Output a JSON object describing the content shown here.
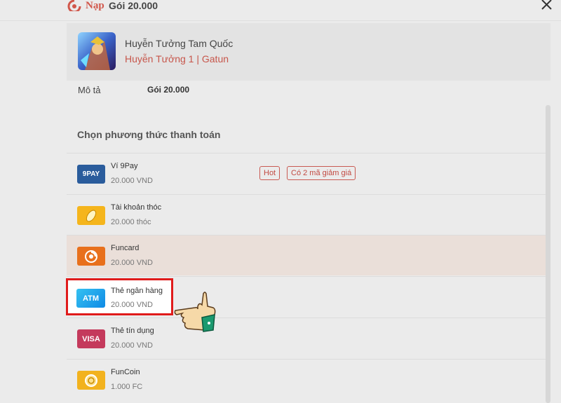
{
  "header": {
    "brand": "Nạp",
    "title": "Gói 20.000"
  },
  "game": {
    "name": "Huyễn Tưởng Tam Quốc",
    "server": "Huyễn Tưởng 1 | Gatun"
  },
  "description": {
    "label": "Mô tả",
    "value": "Gói 20.000"
  },
  "section_title": "Chọn phương thức thanh toán",
  "methods": [
    {
      "name": "Ví 9Pay",
      "price": "20.000 VND",
      "icon_text": "9PAY",
      "icon": "9pay-icon",
      "color": "#2a5c9c",
      "badges": [
        "Hot",
        "Có 2 mã giảm giá"
      ]
    },
    {
      "name": "Tài khoản thóc",
      "price": "20.000 thóc",
      "icon": "rice-grain-icon",
      "color": "#f5b51c"
    },
    {
      "name": "Funcard",
      "price": "20.000 VND",
      "icon": "funcard-icon",
      "color": "#e8701c"
    },
    {
      "name": "Thẻ ngân hàng",
      "price": "20.000 VND",
      "icon_text": "ATM",
      "icon": "atm-card-icon",
      "color": "#1aa3ee"
    },
    {
      "name": "Thẻ tín dụng",
      "price": "20.000 VND",
      "icon_text": "VISA",
      "icon": "visa-icon",
      "color": "#c43a5c"
    },
    {
      "name": "FunCoin",
      "price": "1.000 FC",
      "icon": "funcoin-icon",
      "color": "#f2b21e"
    }
  ],
  "colors": {
    "accent_red": "#d1574b",
    "highlight_border": "#e01b1b"
  }
}
